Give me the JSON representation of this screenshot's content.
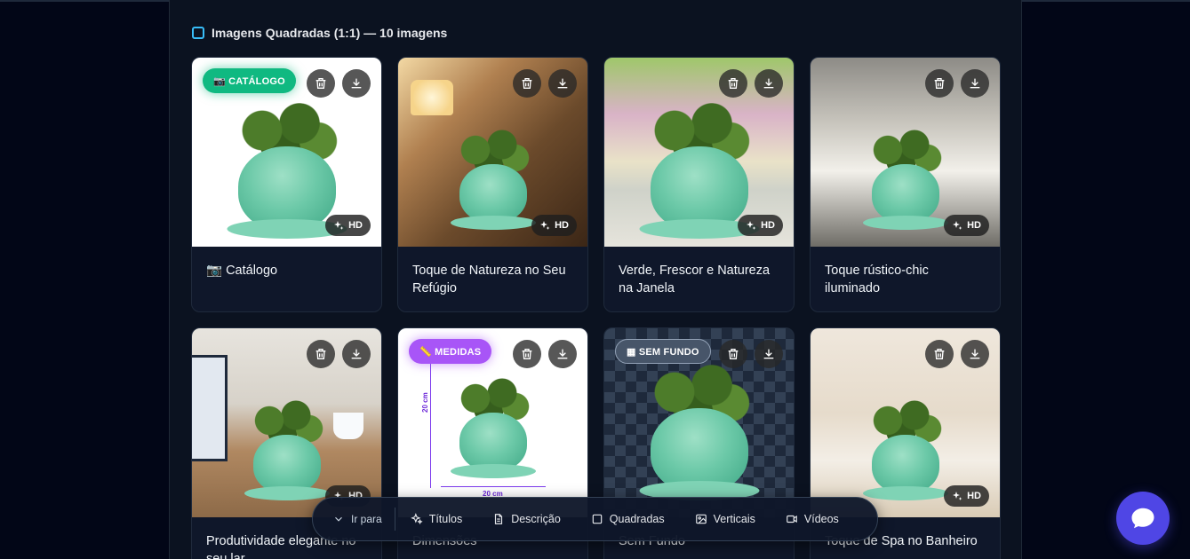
{
  "section": {
    "title": "Imagens Quadradas (1:1) — 10 imagens"
  },
  "cards": [
    {
      "title": "📷 Catálogo",
      "tag": "📷 CATÁLOGO",
      "hd": "HD",
      "bg": "white"
    },
    {
      "title": "Toque de Natureza no Seu Refúgio",
      "tag": "",
      "hd": "HD",
      "bg": "bedroom"
    },
    {
      "title": "Verde, Frescor e Natureza na Janela",
      "tag": "",
      "hd": "HD",
      "bg": "window"
    },
    {
      "title": "Toque rústico-chic iluminado",
      "tag": "",
      "hd": "HD",
      "bg": "brick"
    },
    {
      "title": "Produtividade elegante no seu lar",
      "tag": "",
      "hd": "HD",
      "bg": "desk"
    },
    {
      "title": "Dimensões",
      "tag": "📏 MEDIDAS",
      "hd": "",
      "bg": "white",
      "dim_v": "20 cm",
      "dim_h": "20 cm"
    },
    {
      "title": "Sem Fundo",
      "tag": "▦ SEM FUNDO",
      "hd": "",
      "bg": "checker"
    },
    {
      "title": "Toque de Spa no Banheiro",
      "tag": "",
      "hd": "HD",
      "bg": "spa"
    }
  ],
  "navbar": {
    "goto": "Ir para",
    "items": [
      {
        "label": "Títulos",
        "icon": "sparkles-icon"
      },
      {
        "label": "Descrição",
        "icon": "document-icon"
      },
      {
        "label": "Quadradas",
        "icon": "square-icon"
      },
      {
        "label": "Verticais",
        "icon": "image-icon"
      },
      {
        "label": "Vídeos",
        "icon": "video-icon"
      }
    ]
  },
  "colors": {
    "background": "#020617",
    "panel": "#0b1220",
    "tag_catalog": "#10b981",
    "tag_measures": "#a855f7",
    "chat_button": "#4f46e5"
  }
}
